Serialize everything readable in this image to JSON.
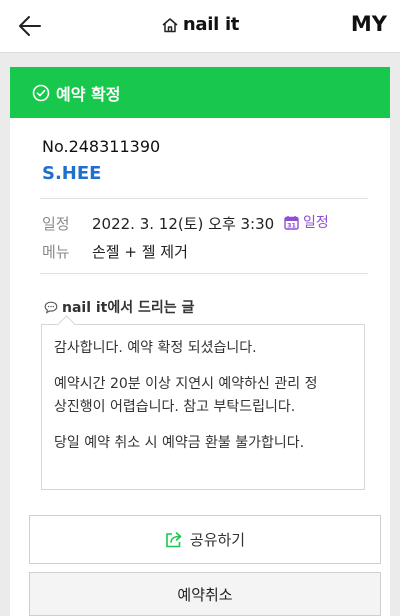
{
  "header": {
    "brand": "nail it",
    "my_label": "MY",
    "icons": {
      "back": "arrow-left-icon",
      "home": "home-icon"
    }
  },
  "status": {
    "label": "예약 확정",
    "icon": "check-circle-icon",
    "color": "#17c84c"
  },
  "booking": {
    "number": "No.248311390",
    "customer": "S.HEE",
    "date_label": "일정",
    "date_value": "2022. 3. 12(토) 오후 3:30",
    "calendar_link": "일정",
    "calendar_icon": "calendar-icon",
    "menu_label": "메뉴",
    "menu_value": "손젤 + 젤 제거"
  },
  "message": {
    "title": "nail it에서 드리는 글",
    "icon": "speech-bubble-icon",
    "lines": [
      "감사합니다. 예약 확정 되셨습니다.",
      "예약시간 20분 이상 지연시 예약하신 관리 정",
      "상진행이 어렵습니다. 참고 부탁드립니다.",
      "당일 예약 취소 시 예약금 환불 불가합니다."
    ]
  },
  "actions": {
    "share": "공유하기",
    "share_icon": "share-icon",
    "cancel": "예약취소"
  },
  "colors": {
    "accent": "#17c84c",
    "name": "#1f6fd1",
    "calendar": "#8e4fd6"
  }
}
